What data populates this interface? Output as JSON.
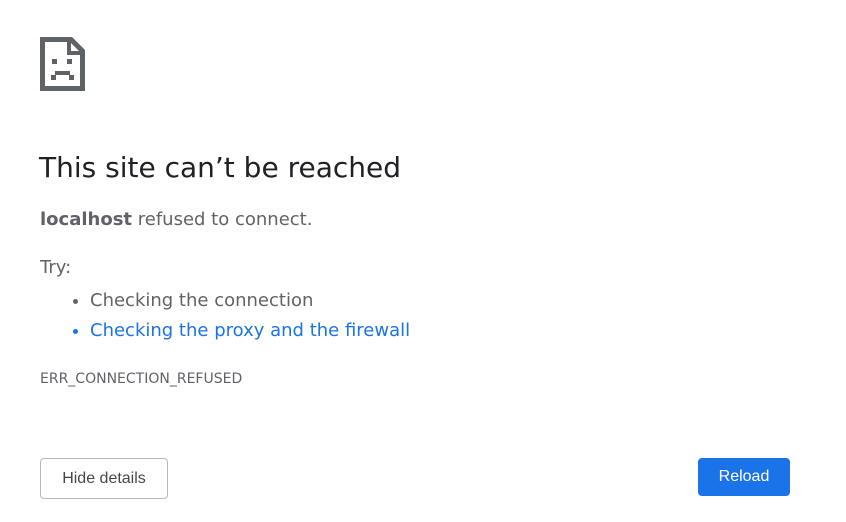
{
  "error": {
    "icon": "sad-page-icon",
    "title": "This site can’t be reached",
    "host": "localhost",
    "message_suffix": " refused to connect.",
    "try_label": "Try:",
    "suggestions": [
      "Checking the connection",
      "Checking the proxy and the firewall"
    ],
    "code": "ERR_CONNECTION_REFUSED"
  },
  "buttons": {
    "details_label": "Hide details",
    "reload_label": "Reload"
  },
  "colors": {
    "link": "#1a73e8",
    "primary_button": "#1a73e8",
    "text_secondary": "#5f6368",
    "title": "#202124"
  }
}
